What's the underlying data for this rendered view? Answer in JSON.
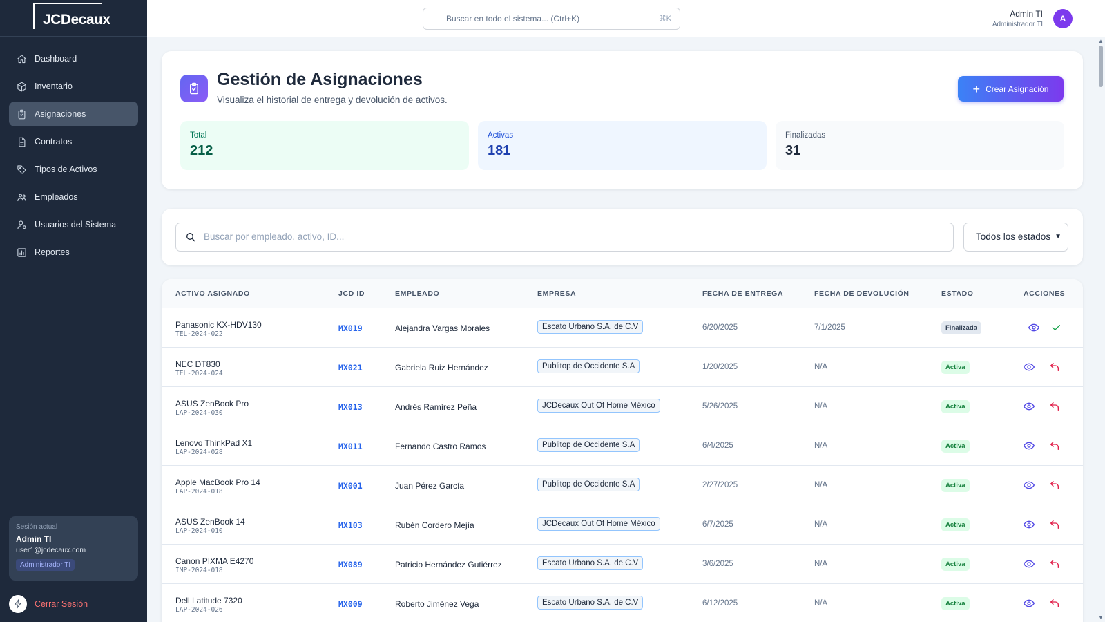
{
  "brand": {
    "logo_text": "JCDecaux"
  },
  "sidebar": {
    "items": [
      {
        "label": "Dashboard",
        "icon": "home-icon"
      },
      {
        "label": "Inventario",
        "icon": "box-icon"
      },
      {
        "label": "Asignaciones",
        "icon": "clipboard-icon",
        "active": true
      },
      {
        "label": "Contratos",
        "icon": "document-icon"
      },
      {
        "label": "Tipos de Activos",
        "icon": "tag-icon"
      },
      {
        "label": "Empleados",
        "icon": "users-icon"
      },
      {
        "label": "Usuarios del Sistema",
        "icon": "user-cog-icon"
      },
      {
        "label": "Reportes",
        "icon": "report-icon"
      }
    ],
    "session": {
      "label": "Sesión actual",
      "name": "Admin TI",
      "email": "user1@jcdecaux.com",
      "role": "Administrador TI"
    },
    "logout_label": "Cerrar Sesión"
  },
  "topbar": {
    "search_placeholder": "Buscar en todo el sistema... (Ctrl+K)",
    "shortcut": "⌘K",
    "user_name": "Admin TI",
    "user_role": "Administrador TI",
    "avatar_initial": "A"
  },
  "header": {
    "title": "Gestión de Asignaciones",
    "subtitle": "Visualiza el historial de entrega y devolución de activos.",
    "create_button": "Crear Asignación",
    "stats": {
      "total_label": "Total",
      "total_value": "212",
      "active_label": "Activas",
      "active_value": "181",
      "done_label": "Finalizadas",
      "done_value": "31"
    }
  },
  "filters": {
    "search_placeholder": "Buscar por empleado, activo, ID...",
    "status_selected": "Todos los estados"
  },
  "table": {
    "columns": [
      "ACTIVO ASIGNADO",
      "JCD ID",
      "EMPLEADO",
      "EMPRESA",
      "FECHA DE ENTREGA",
      "FECHA DE DEVOLUCIÓN",
      "ESTADO",
      "ACCIONES"
    ],
    "rows": [
      {
        "asset": "Panasonic KX-HDV130",
        "code": "TEL-2024-022",
        "jcd": "MX019",
        "employee": "Alejandra Vargas Morales",
        "company": "Escato Urbano S.A. de C.V",
        "delivery": "6/20/2025",
        "return": "7/1/2025",
        "status": "Finalizada"
      },
      {
        "asset": "NEC DT830",
        "code": "TEL-2024-024",
        "jcd": "MX021",
        "employee": "Gabriela Ruiz Hernández",
        "company": "Publitop de Occidente S.A",
        "delivery": "1/20/2025",
        "return": "N/A",
        "status": "Activa"
      },
      {
        "asset": "ASUS ZenBook Pro",
        "code": "LAP-2024-030",
        "jcd": "MX013",
        "employee": "Andrés Ramírez Peña",
        "company": "JCDecaux Out Of Home México",
        "delivery": "5/26/2025",
        "return": "N/A",
        "status": "Activa"
      },
      {
        "asset": "Lenovo ThinkPad X1",
        "code": "LAP-2024-028",
        "jcd": "MX011",
        "employee": "Fernando Castro Ramos",
        "company": "Publitop de Occidente S.A",
        "delivery": "6/4/2025",
        "return": "N/A",
        "status": "Activa"
      },
      {
        "asset": "Apple MacBook Pro 14",
        "code": "LAP-2024-018",
        "jcd": "MX001",
        "employee": "Juan Pérez García",
        "company": "Publitop de Occidente S.A",
        "delivery": "2/27/2025",
        "return": "N/A",
        "status": "Activa"
      },
      {
        "asset": "ASUS ZenBook 14",
        "code": "LAP-2024-010",
        "jcd": "MX103",
        "employee": "Rubén Cordero Mejía",
        "company": "JCDecaux Out Of Home México",
        "delivery": "6/7/2025",
        "return": "N/A",
        "status": "Activa"
      },
      {
        "asset": "Canon PIXMA E4270",
        "code": "IMP-2024-018",
        "jcd": "MX089",
        "employee": "Patricio Hernández Gutiérrez",
        "company": "Escato Urbano S.A. de C.V",
        "delivery": "3/6/2025",
        "return": "N/A",
        "status": "Activa"
      },
      {
        "asset": "Dell Latitude 7320",
        "code": "LAP-2024-026",
        "jcd": "MX009",
        "employee": "Roberto Jiménez Vega",
        "company": "Escato Urbano S.A. de C.V",
        "delivery": "6/12/2025",
        "return": "N/A",
        "status": "Activa"
      }
    ]
  },
  "colors": {
    "sidebar_bg": "#1e293b",
    "accent": "#4f46e5",
    "active_badge": "#dcfce7",
    "link": "#2563eb"
  }
}
